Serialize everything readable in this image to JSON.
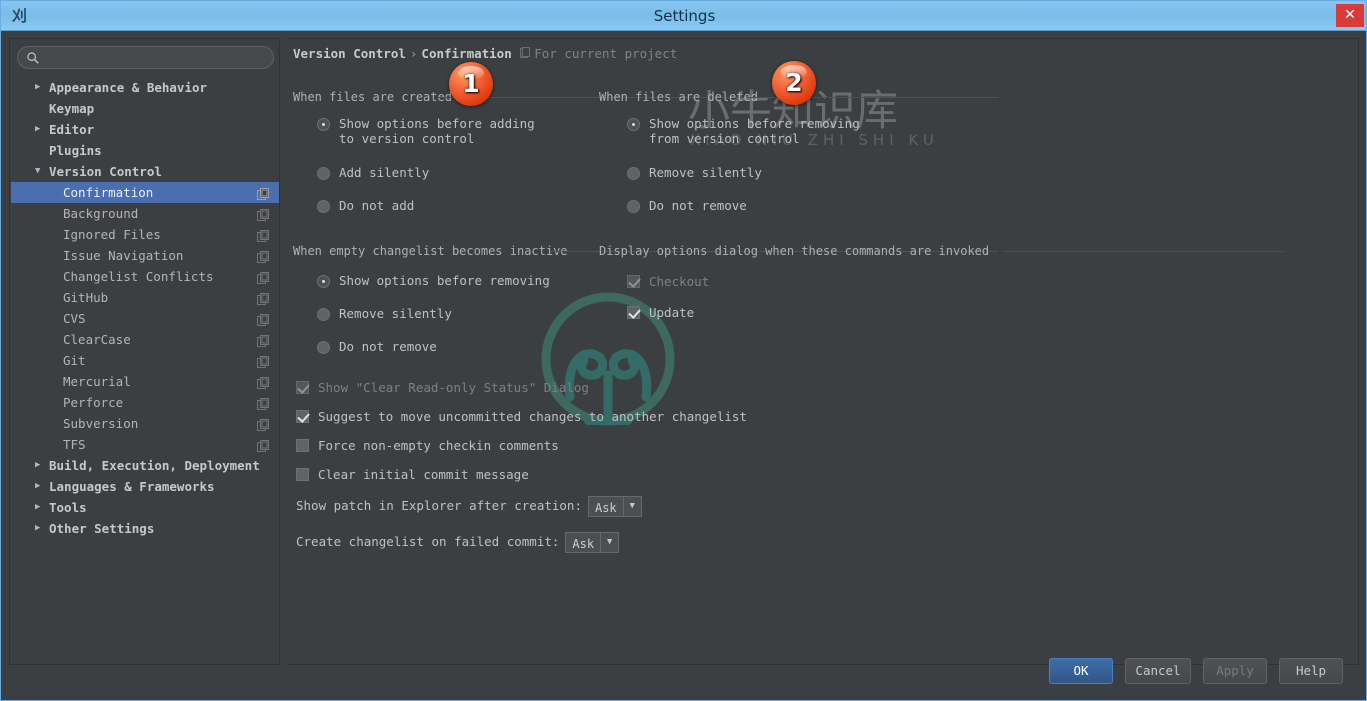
{
  "window": {
    "title": "Settings",
    "app_icon": "intellij-idea-icon",
    "close_label": "✕"
  },
  "sidebar": {
    "search": {
      "value": "",
      "placeholder": "",
      "icon": "search-icon"
    },
    "items": [
      {
        "label": "Appearance & Behavior",
        "level": "top",
        "arrow": "▶",
        "expanded": false,
        "selected": false,
        "copy_icon": false
      },
      {
        "label": "Keymap",
        "level": "top",
        "arrow": "",
        "expanded": false,
        "selected": false,
        "copy_icon": false
      },
      {
        "label": "Editor",
        "level": "top",
        "arrow": "▶",
        "expanded": false,
        "selected": false,
        "copy_icon": false
      },
      {
        "label": "Plugins",
        "level": "top",
        "arrow": "",
        "expanded": false,
        "selected": false,
        "copy_icon": false
      },
      {
        "label": "Version Control",
        "level": "top",
        "arrow": "▼",
        "expanded": true,
        "selected": false,
        "copy_icon": false
      },
      {
        "label": "Confirmation",
        "level": "child",
        "arrow": "",
        "expanded": false,
        "selected": true,
        "copy_icon": true
      },
      {
        "label": "Background",
        "level": "child",
        "arrow": "",
        "expanded": false,
        "selected": false,
        "copy_icon": true
      },
      {
        "label": "Ignored Files",
        "level": "child",
        "arrow": "",
        "expanded": false,
        "selected": false,
        "copy_icon": true
      },
      {
        "label": "Issue Navigation",
        "level": "child",
        "arrow": "",
        "expanded": false,
        "selected": false,
        "copy_icon": true
      },
      {
        "label": "Changelist Conflicts",
        "level": "child",
        "arrow": "",
        "expanded": false,
        "selected": false,
        "copy_icon": true
      },
      {
        "label": "GitHub",
        "level": "child",
        "arrow": "",
        "expanded": false,
        "selected": false,
        "copy_icon": true
      },
      {
        "label": "CVS",
        "level": "child",
        "arrow": "",
        "expanded": false,
        "selected": false,
        "copy_icon": true
      },
      {
        "label": "ClearCase",
        "level": "child",
        "arrow": "",
        "expanded": false,
        "selected": false,
        "copy_icon": true
      },
      {
        "label": "Git",
        "level": "child",
        "arrow": "",
        "expanded": false,
        "selected": false,
        "copy_icon": true
      },
      {
        "label": "Mercurial",
        "level": "child",
        "arrow": "",
        "expanded": false,
        "selected": false,
        "copy_icon": true
      },
      {
        "label": "Perforce",
        "level": "child",
        "arrow": "",
        "expanded": false,
        "selected": false,
        "copy_icon": true
      },
      {
        "label": "Subversion",
        "level": "child",
        "arrow": "",
        "expanded": false,
        "selected": false,
        "copy_icon": true
      },
      {
        "label": "TFS",
        "level": "child",
        "arrow": "",
        "expanded": false,
        "selected": false,
        "copy_icon": true
      },
      {
        "label": "Build, Execution, Deployment",
        "level": "top",
        "arrow": "▶",
        "expanded": false,
        "selected": false,
        "copy_icon": false
      },
      {
        "label": "Languages & Frameworks",
        "level": "top",
        "arrow": "▶",
        "expanded": false,
        "selected": false,
        "copy_icon": false
      },
      {
        "label": "Tools",
        "level": "top",
        "arrow": "▶",
        "expanded": false,
        "selected": false,
        "copy_icon": false
      },
      {
        "label": "Other Settings",
        "level": "top",
        "arrow": "▶",
        "expanded": false,
        "selected": false,
        "copy_icon": false
      }
    ]
  },
  "main": {
    "breadcrumb": {
      "root": "Version Control",
      "separator": "›",
      "leaf": "Confirmation",
      "scope_icon": "project-scope-icon",
      "scope": "For current project"
    },
    "sections": {
      "created": {
        "header": "When files are created"
      },
      "deleted": {
        "header": "When files are deleted"
      },
      "inactive": {
        "header": "When empty changelist becomes inactive"
      },
      "display": {
        "header": "Display options dialog when these commands are invoked"
      }
    },
    "radios_created": [
      {
        "label_line1": "Show options before adding",
        "label_line2": "to version control",
        "checked": true,
        "mnemonic": ""
      },
      {
        "label_line1": "Add silently",
        "label_line2": "",
        "checked": false,
        "mnemonic": "A"
      },
      {
        "label_line1": "Do not add",
        "label_line2": "",
        "checked": false,
        "mnemonic": "D"
      }
    ],
    "radios_deleted": [
      {
        "label_line1": "Show options before removing",
        "label_line2": "from version control",
        "checked": true,
        "mnemonic": ""
      },
      {
        "label_line1": "Remove silently",
        "label_line2": "",
        "checked": false,
        "mnemonic": "m"
      },
      {
        "label_line1": "Do not remove",
        "label_line2": "",
        "checked": false,
        "mnemonic": "n"
      }
    ],
    "radios_inactive": [
      {
        "label_line1": "Show options before removing",
        "label_line2": "",
        "checked": true,
        "mnemonic": ""
      },
      {
        "label_line1": "Remove silently",
        "label_line2": "",
        "checked": false,
        "mnemonic": ""
      },
      {
        "label_line1": "Do not remove",
        "label_line2": "",
        "checked": false,
        "mnemonic": ""
      }
    ],
    "checks_display": [
      {
        "label": "Checkout",
        "checked": true,
        "disabled": true
      },
      {
        "label": "Update",
        "checked": true,
        "disabled": false
      }
    ],
    "checks_bottom": [
      {
        "label": "Show \"Clear Read-only Status\" Dialog",
        "checked": true,
        "disabled": true
      },
      {
        "label": "Suggest to move uncommitted changes to another changelist",
        "checked": true,
        "disabled": false
      },
      {
        "label": "Force non-empty checkin comments",
        "checked": false,
        "disabled": false
      },
      {
        "label": "Clear initial commit message",
        "checked": false,
        "disabled": false
      }
    ],
    "combos": [
      {
        "label": "Show patch in Explorer after creation:",
        "value": "Ask",
        "arrow": "▼"
      },
      {
        "label": "Create changelist on failed commit:",
        "value": "Ask",
        "arrow": "▼"
      }
    ]
  },
  "badges": [
    {
      "number": "1"
    },
    {
      "number": "2"
    }
  ],
  "watermark": {
    "text": "小牛知识库",
    "sub": "XIAO NIU ZHI SHI KU"
  },
  "footer": {
    "buttons": [
      {
        "label": "OK",
        "kind": "default"
      },
      {
        "label": "Cancel",
        "kind": "normal"
      },
      {
        "label": "Apply",
        "kind": "disabled"
      },
      {
        "label": "Help",
        "kind": "normal"
      }
    ]
  },
  "colors": {
    "window_bg": "#3c3f41",
    "titlebar": "#7fc0ec",
    "selection": "#4b6eaf",
    "accent_badge": "#e8450f",
    "default_button": "#3a6395",
    "close_button": "#d93b3b"
  }
}
